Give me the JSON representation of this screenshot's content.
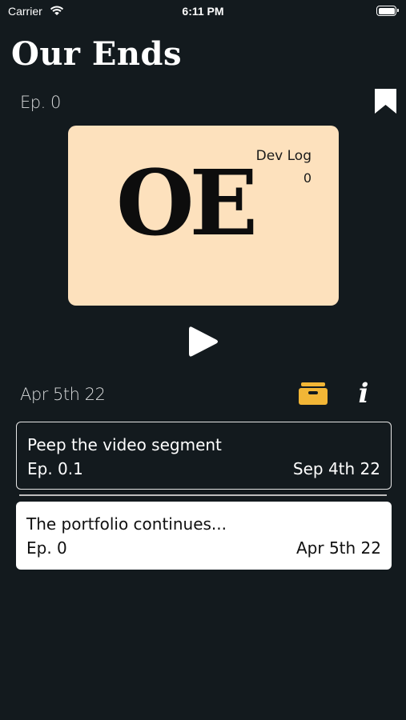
{
  "status_bar": {
    "carrier": "Carrier",
    "time": "6:11 PM"
  },
  "header": {
    "title": "Our Ends",
    "episode": "Ep. 0",
    "bookmark_icon": "bookmark-icon"
  },
  "artwork": {
    "caption_line1": "Dev Log",
    "caption_line2": "0",
    "logo_text": "OE",
    "background": "#fde1bd"
  },
  "player": {
    "play_icon": "play-icon",
    "date": "Apr 5th 22",
    "archive_icon": "archive-icon",
    "info_icon": "i",
    "archive_color": "#f2b636"
  },
  "episodes": [
    {
      "title": "Peep the video segment",
      "ep": "Ep. 0.1",
      "date": "Sep 4th 22"
    },
    {
      "title": "The portfolio continues...",
      "ep": "Ep. 0",
      "date": "Apr 5th 22"
    }
  ]
}
